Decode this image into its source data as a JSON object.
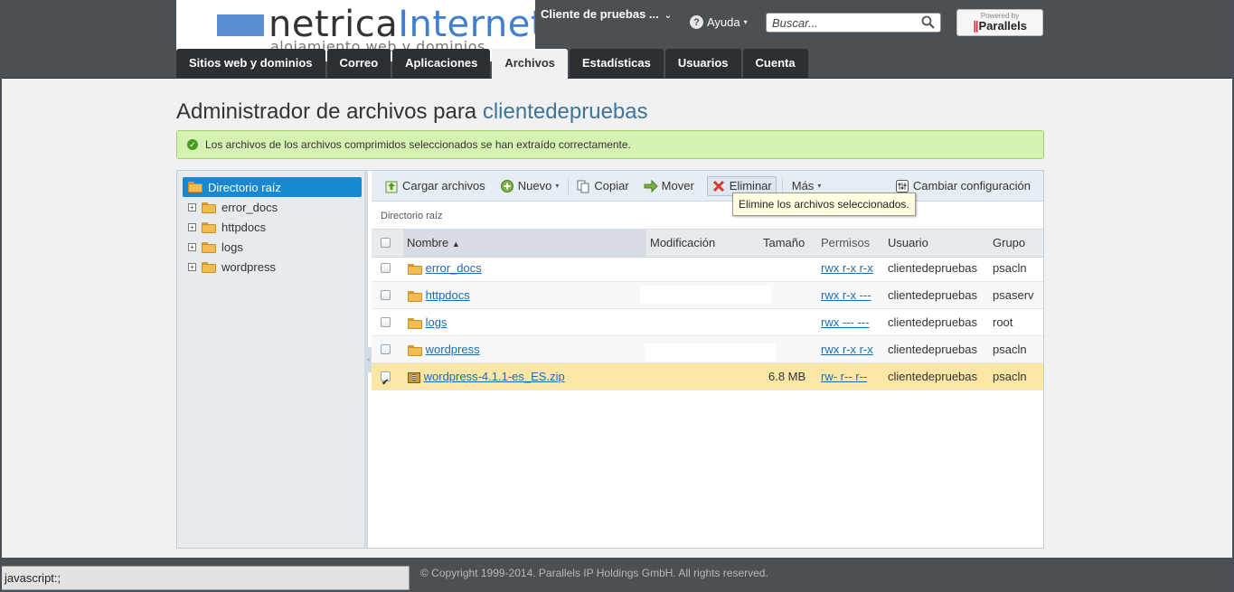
{
  "brand": {
    "logo_part1": "netrica",
    "logo_part2": "Internet",
    "logo_sub": "alojamiento web y dominios",
    "accent": "#3f7fcf"
  },
  "header": {
    "client_selector": "Cliente de pruebas ...",
    "help_label": "Ayuda",
    "search_placeholder": "Buscar...",
    "powered_by": "Powered by",
    "powered_brand": "Parallels"
  },
  "tabs": [
    {
      "label": "Sitios web y dominios",
      "active": false
    },
    {
      "label": "Correo",
      "active": false
    },
    {
      "label": "Aplicaciones",
      "active": false
    },
    {
      "label": "Archivos",
      "active": true
    },
    {
      "label": "Estadísticas",
      "active": false
    },
    {
      "label": "Usuarios",
      "active": false
    },
    {
      "label": "Cuenta",
      "active": false
    }
  ],
  "page": {
    "title_prefix": "Administrador de archivos para",
    "title_user": "clientedepruebas",
    "success_message": "Los archivos de los archivos comprimidos seleccionados se han extraído correctamente."
  },
  "tree": {
    "root": "Directorio raíz",
    "items": [
      "error_docs",
      "httpdocs",
      "logs",
      "wordpress"
    ]
  },
  "toolbar": {
    "upload": "Cargar archivos",
    "new": "Nuevo",
    "copy": "Copiar",
    "move": "Mover",
    "delete": "Eliminar",
    "more": "Más",
    "settings": "Cambiar configuración",
    "tooltip": "Elimine los archivos seleccionados."
  },
  "breadcrumb": "Directorio raíz",
  "table": {
    "headers": {
      "name": "Nombre",
      "modified": "Modificación",
      "size": "Tamaño",
      "perms": "Permisos",
      "user": "Usuario",
      "group": "Grupo"
    },
    "rows": [
      {
        "name": "error_docs",
        "size": "",
        "perms": "rwx r-x r-x",
        "user": "clientedepruebas",
        "group": "psacln",
        "type": "folder",
        "checked": false
      },
      {
        "name": "httpdocs",
        "size": "",
        "perms": "rwx r-x ---",
        "user": "clientedepruebas",
        "group": "psaserv",
        "type": "folder",
        "checked": false
      },
      {
        "name": "logs",
        "size": "",
        "perms": "rwx --- ---",
        "user": "clientedepruebas",
        "group": "root",
        "type": "folder",
        "checked": false
      },
      {
        "name": "wordpress",
        "size": "",
        "perms": "rwx r-x r-x",
        "user": "clientedepruebas",
        "group": "psacln",
        "type": "folder",
        "checked": false
      },
      {
        "name": "wordpress-4.1.1-es_ES.zip",
        "size": "6.8 MB",
        "perms": "rw- r-- r--",
        "user": "clientedepruebas",
        "group": "psacln",
        "type": "zip",
        "checked": true
      }
    ]
  },
  "footer": {
    "copyright": "© Copyright 1999-2014. Parallels IP Holdings GmbH. All rights reserved."
  },
  "statusbar": "javascript:;"
}
